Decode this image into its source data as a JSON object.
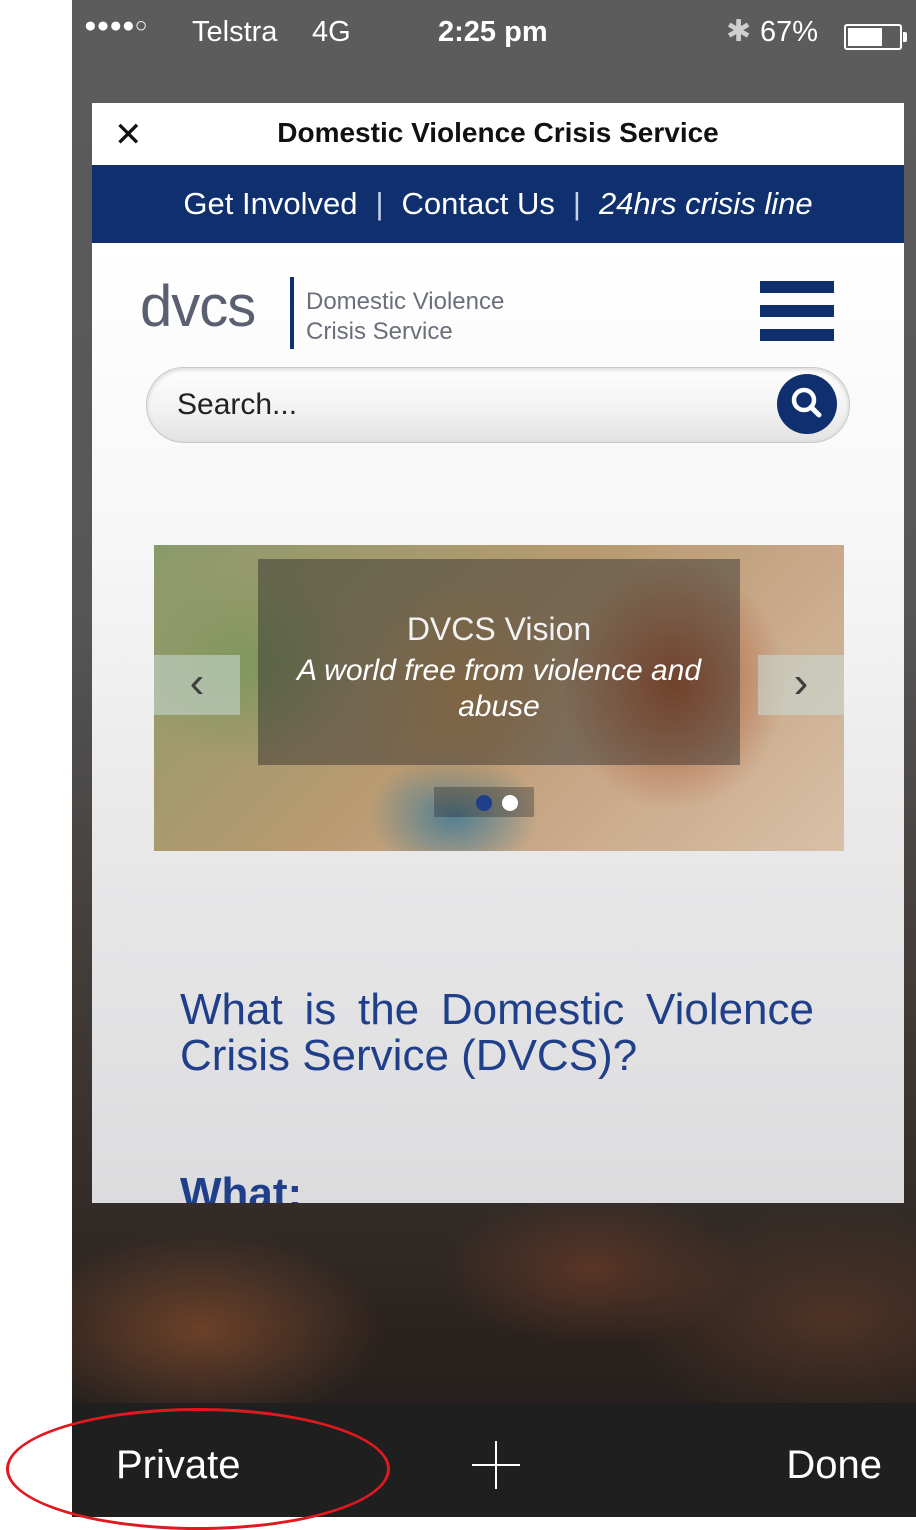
{
  "status_bar": {
    "signal": "●●●●○",
    "carrier": "Telstra",
    "network": "4G",
    "time": "2:25 pm",
    "bluetooth_icon": "bluetooth-icon",
    "battery_percent_text": "67%",
    "battery_level": 0.67
  },
  "tab": {
    "close_icon": "close-icon",
    "title": "Domestic Violence Crisis Service"
  },
  "top_nav": {
    "get_involved": "Get Involved",
    "separator": "|",
    "contact_us": "Contact Us",
    "crisis_line": "24hrs crisis line"
  },
  "site": {
    "logo_mark": "dvcs",
    "logo_line1": "Domestic Violence",
    "logo_line2": "Crisis Service",
    "menu_icon": "hamburger-menu-icon",
    "search_placeholder": "Search...",
    "search_icon": "search-icon"
  },
  "slider": {
    "heading": "DVCS Vision",
    "text": "A world free from violence and abuse",
    "prev_icon": "chevron-left-icon",
    "next_icon": "chevron-right-icon",
    "active_dot": 1,
    "dot_count": 2
  },
  "content": {
    "heading": "What is the Domestic Violence Crisis Service (DVCS)?",
    "subheading": "What:"
  },
  "toolbar": {
    "private_label": "Private",
    "new_tab_icon": "plus-icon",
    "done_label": "Done"
  },
  "colors": {
    "brand_navy": "#0f2f6f",
    "heading_blue": "#1f3f8a",
    "annotation_red": "#e1191f"
  }
}
